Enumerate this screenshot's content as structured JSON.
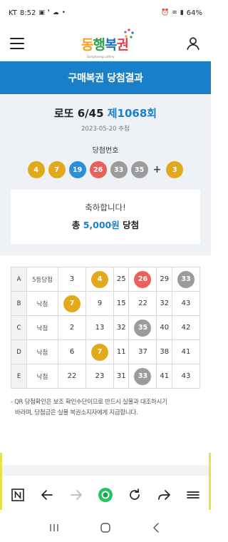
{
  "status_bar": {
    "carrier": "KT",
    "time": "8:52",
    "battery": "64%"
  },
  "header": {
    "logo_text": [
      "동",
      "행",
      "복",
      "권"
    ],
    "logo_sub": "Donghaeng Lottery"
  },
  "title_bar": {
    "title": "구매복권 당첨결과"
  },
  "draw": {
    "game_name": "로또 6/45",
    "round": "제1068회",
    "date": "2023-05-20 추첨",
    "win_label": "당첨번호",
    "plus": "+",
    "numbers": [
      {
        "value": "4",
        "color": "#e3a91c"
      },
      {
        "value": "7",
        "color": "#e3a91c"
      },
      {
        "value": "19",
        "color": "#2b8fd9"
      },
      {
        "value": "26",
        "color": "#e8615b"
      },
      {
        "value": "33",
        "color": "#9b9b9b"
      },
      {
        "value": "35",
        "color": "#9b9b9b"
      }
    ],
    "bonus": {
      "value": "3",
      "color": "#e3a91c"
    }
  },
  "congrats": {
    "message": "축하합니다!",
    "prize_prefix": "총 ",
    "prize_amount": "5,000원",
    "prize_suffix": " 당첨"
  },
  "ticket": {
    "rows": [
      {
        "id": "A",
        "result": "5등당첨",
        "numbers": [
          "3",
          "4",
          "25",
          "26",
          "29",
          "33"
        ],
        "hits": [
          null,
          "#e3a91c",
          null,
          "#e8615b",
          null,
          "#9b9b9b"
        ]
      },
      {
        "id": "B",
        "result": "낙첨",
        "numbers": [
          "7",
          "9",
          "15",
          "22",
          "32",
          "43"
        ],
        "hits": [
          "#e3a91c",
          null,
          null,
          null,
          null,
          null
        ]
      },
      {
        "id": "C",
        "result": "낙첨",
        "numbers": [
          "2",
          "13",
          "32",
          "35",
          "40",
          "42"
        ],
        "hits": [
          null,
          null,
          null,
          "#9b9b9b",
          null,
          null
        ]
      },
      {
        "id": "D",
        "result": "낙첨",
        "numbers": [
          "6",
          "7",
          "11",
          "37",
          "38",
          "41"
        ],
        "hits": [
          null,
          "#e3a91c",
          null,
          null,
          null,
          null
        ]
      },
      {
        "id": "E",
        "result": "낙첨",
        "numbers": [
          "22",
          "23",
          "31",
          "33",
          "41",
          "43"
        ],
        "hits": [
          null,
          null,
          null,
          "#9b9b9b",
          null,
          null
        ]
      }
    ]
  },
  "notice": {
    "line1": "- QR 당첨확인은 보조 확인수단이므로 반드시 실물과 대조하시기",
    "line2": "바라며, 당첨금은 실물 복권소지자에게 지급합니다."
  },
  "browser_bar": {
    "icons": [
      "n-icon",
      "back-arrow-icon",
      "forward-arrow-icon",
      "home-dot-icon",
      "refresh-icon",
      "share-icon",
      "menu-icon"
    ]
  },
  "colors": {
    "accent": "#1a7fc9",
    "background": "#eef1f5"
  }
}
